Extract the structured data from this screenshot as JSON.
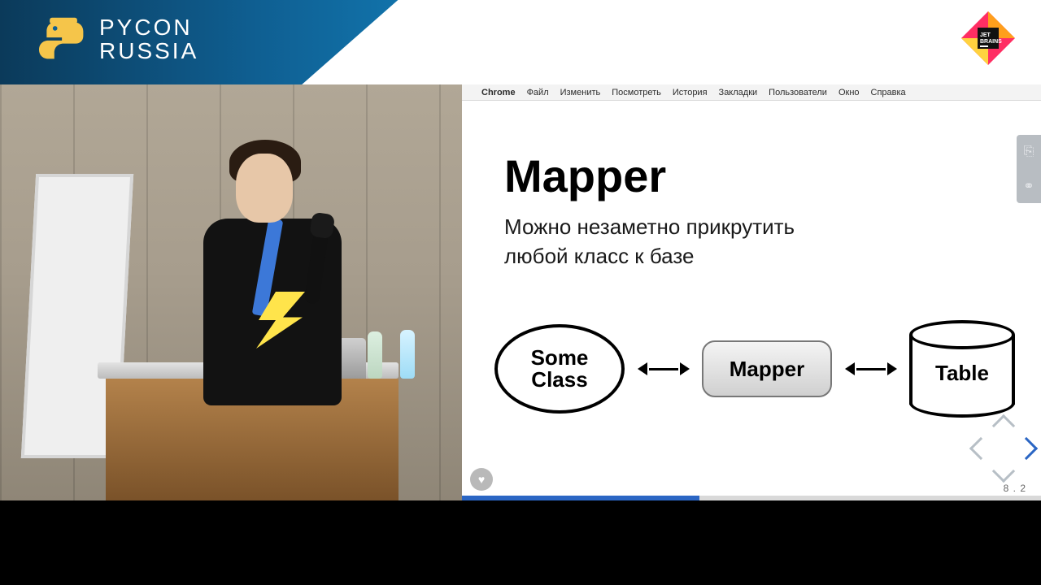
{
  "header": {
    "brand_line1": "PYCON",
    "brand_line2": "RUSSIA",
    "sponsor": "JetBrains"
  },
  "menubar": {
    "apple": "",
    "app": "Chrome",
    "items": [
      "Файл",
      "Изменить",
      "Посмотреть",
      "История",
      "Закладки",
      "Пользователи",
      "Окно",
      "Справка"
    ]
  },
  "slide": {
    "title": "Mapper",
    "subtitle_line1": "Можно незаметно прикрутить",
    "subtitle_line2": "любой класс к базе",
    "node_class": "Some\nClass",
    "node_mapper": "Mapper",
    "node_table": "Table",
    "page": "8 . 2"
  },
  "icons": {
    "heart": "♥",
    "tool_page": "⎘",
    "tool_link": "⚭"
  }
}
